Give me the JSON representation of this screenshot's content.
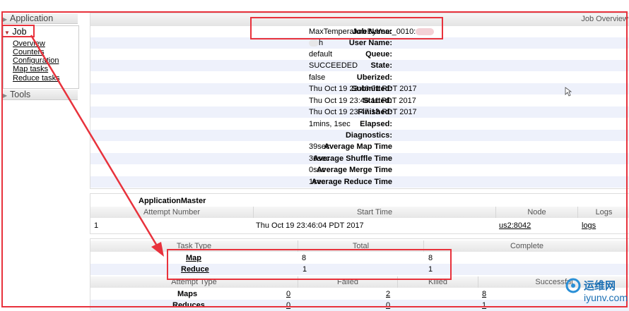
{
  "sidebar": {
    "application_label": "Application",
    "job_label": "Job",
    "job_links": [
      "Overview",
      "Counters",
      "Configuration",
      "Map tasks",
      "Reduce tasks"
    ],
    "tools_label": "Tools"
  },
  "overview": {
    "header": "Job Overview",
    "rows": [
      {
        "label": "Job Name:",
        "value": "MaxTemperatureByYear_0010:"
      },
      {
        "label": "User Name:",
        "value": "h"
      },
      {
        "label": "Queue:",
        "value": "default"
      },
      {
        "label": "State:",
        "value": "SUCCEEDED"
      },
      {
        "label": "Uberized:",
        "value": "false"
      },
      {
        "label": "Submitted:",
        "value": "Thu Oct 19 23:46:01 PDT 2017"
      },
      {
        "label": "Started:",
        "value": "Thu Oct 19 23:46:11 PDT 2017"
      },
      {
        "label": "Finished:",
        "value": "Thu Oct 19 23:47:13 PDT 2017"
      },
      {
        "label": "Elapsed:",
        "value": "1mins, 1sec"
      },
      {
        "label": "Diagnostics:",
        "value": ""
      },
      {
        "label": "Average Map Time",
        "value": "39sec"
      },
      {
        "label": "Average Shuffle Time",
        "value": "36sec"
      },
      {
        "label": "Average Merge Time",
        "value": "0sec"
      },
      {
        "label": "Average Reduce Time",
        "value": "1sec"
      }
    ]
  },
  "am": {
    "title": "ApplicationMaster",
    "headers": [
      "Attempt Number",
      "Start Time",
      "Node",
      "Logs"
    ],
    "row": {
      "attempt": "1",
      "start": "Thu Oct 19 23:46:04 PDT 2017",
      "node": "us2:8042",
      "logs": "logs"
    }
  },
  "tasks": {
    "headers": [
      "Task Type",
      "Total",
      "Complete"
    ],
    "rows": [
      {
        "type": "Map",
        "total": "8",
        "complete": "8"
      },
      {
        "type": "Reduce",
        "total": "1",
        "complete": "1"
      }
    ]
  },
  "attempts": {
    "headers": [
      "Attempt Type",
      "Failed",
      "Killed",
      "Successful"
    ],
    "rows": [
      {
        "type": "Maps",
        "failed": "0",
        "killed": "2",
        "successful": "8"
      },
      {
        "type": "Reduces",
        "failed": "0",
        "killed": "0",
        "successful": "1"
      }
    ]
  },
  "watermark": {
    "cn": "运维网",
    "url": "iyunv.com"
  }
}
